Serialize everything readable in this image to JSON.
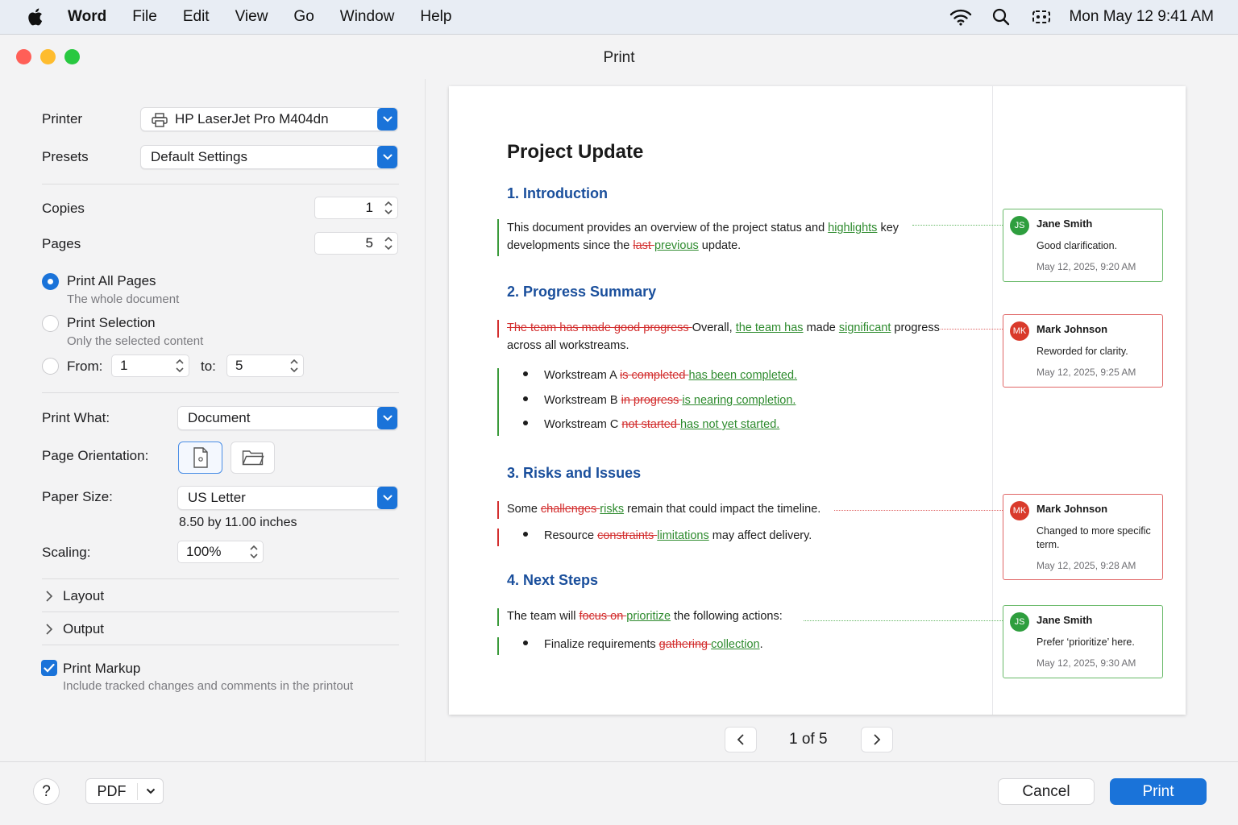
{
  "menubar": {
    "app": "Word",
    "items": [
      "File",
      "Edit",
      "View",
      "Go",
      "Window",
      "Help"
    ],
    "clock": "Mon May 12  9:41 AM"
  },
  "window": {
    "title": "Print"
  },
  "settings": {
    "printer_label": "Printer",
    "printer_value": "HP LaserJet Pro M404dn",
    "presets_label": "Presets",
    "presets_value": "Default Settings",
    "copies_label": "Copies",
    "copies_value": "1",
    "pages_label": "Pages",
    "pages_value": "5",
    "print_all_label": "Print All Pages",
    "print_all_sub": "The whole document",
    "print_selection_label": "Print Selection",
    "print_selection_sub": "Only the selected content",
    "from_label": "From:",
    "from_value": "1",
    "to_label": "to:",
    "to_value": "5",
    "print_what_label": "Print What:",
    "print_what_value": "Document",
    "orientation_label": "Page Orientation:",
    "paper_size_label": "Paper Size:",
    "paper_size_value": "US Letter",
    "paper_size_dims": "8.50 by 11.00 inches",
    "scaling_label": "Scaling:",
    "scaling_value": "100%",
    "layout_label": "Layout",
    "output_label": "Output",
    "print_markup_label": "Print Markup",
    "print_markup_sub": "Include tracked changes and comments in the printout"
  },
  "document": {
    "title": "Project Update",
    "s1_heading": "1. Introduction",
    "s1_p_a": "This document provides an overview of the project status and ",
    "s1_p_ins1": "highlights",
    "s1_p_b": " key",
    "s1_p_c": "developments since the ",
    "s1_p_del1": "last ",
    "s1_p_ins2": "previous",
    "s1_p_d": " update.",
    "s2_heading": "2. Progress Summary",
    "s2_del1": "The team has made good progress ",
    "s2_a": "Overall, ",
    "s2_ins1": "the team has",
    "s2_b": " made ",
    "s2_ins2": "significant",
    "s2_c": " progress",
    "s2_d": "across all workstreams.",
    "b1_a": "Workstream A ",
    "b1_del": "is completed ",
    "b1_ins": "has been completed.",
    "b2_a": "Workstream B ",
    "b2_del": "in progress ",
    "b2_ins": "is nearing completion.",
    "b3_a": "Workstream C ",
    "b3_del": "not started ",
    "b3_ins": "has not yet started.",
    "s3_heading": "3. Risks and Issues",
    "s3_a": "Some ",
    "s3_del": "challenges ",
    "s3_ins": "risks",
    "s3_b": " remain that could impact the timeline.",
    "b4_a": "Resource ",
    "b4_del": "constraints ",
    "b4_ins": "limitations",
    "b4_b": " may affect delivery.",
    "s4_heading": "4. Next Steps",
    "s4_a": "The team will ",
    "s4_del": "focus on ",
    "s4_ins": "prioritize",
    "s4_b": " the following actions:",
    "b5_a": "Finalize requirements ",
    "b5_del": "gathering ",
    "b5_ins": "collection",
    "b5_b": "."
  },
  "comments": [
    {
      "initials": "JS",
      "author": "Jane Smith",
      "text": "Good clarification.",
      "date": "May 12, 2025, 9:20 AM",
      "color": "#2e9e3e"
    },
    {
      "initials": "MK",
      "author": "Mark Johnson",
      "text": "Reworded for clarity.",
      "date": "May 12, 2025, 9:25 AM",
      "color": "#d93a2b"
    },
    {
      "initials": "MK",
      "author": "Mark Johnson",
      "text": "Changed to more specific term.",
      "date": "May 12, 2025, 9:28 AM",
      "color": "#d93a2b"
    },
    {
      "initials": "JS",
      "author": "Jane Smith",
      "text": "Prefer ‘prioritize’ here.",
      "date": "May 12, 2025, 9:30 AM",
      "color": "#2e9e3e"
    }
  ],
  "pager": {
    "text": "1 of 5"
  },
  "footer": {
    "help": "?",
    "pdf": "PDF",
    "cancel": "Cancel",
    "print": "Print"
  },
  "colors": {
    "accent": "#1a73d9",
    "insert": "#2e8b2e",
    "delete": "#d32f2f",
    "heading": "#1a4f9c"
  }
}
